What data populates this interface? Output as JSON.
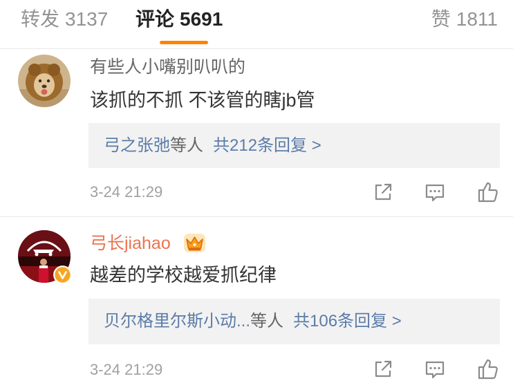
{
  "tabs": [
    {
      "label": "转发",
      "count": "3137"
    },
    {
      "label": "评论",
      "count": "5691"
    },
    {
      "label": "赞",
      "count": "1811"
    }
  ],
  "active_tab": "评论",
  "colors": {
    "accent": "#ff8200",
    "link": "#5b7ca8",
    "vip_name": "#eb7350",
    "text": "#333333",
    "muted": "#a0a0a0",
    "reply_bg": "#f2f2f2",
    "icon": "#8a8a8a"
  },
  "comments": [
    {
      "avatar": "lion-avatar",
      "verified": false,
      "username": "有些人小嘴别叭叭的",
      "badge": null,
      "text": "该抓的不抓 不该管的瞎jb管",
      "reply_users": "弓之张弛",
      "reply_suffix": "等人",
      "reply_summary": "共212条回复 >",
      "time": "3-24 21:29",
      "actions": [
        "share-icon",
        "comment-icon",
        "like-icon"
      ]
    },
    {
      "avatar": "football-fan-avatar",
      "verified": true,
      "username": "弓长jiahao",
      "badge": "crown-icon",
      "text": "越差的学校越爱抓纪律",
      "reply_users": "贝尔格里尔斯小动...",
      "reply_suffix": "等人",
      "reply_summary": "共106条回复 >",
      "time": "3-24 21:29",
      "actions": [
        "share-icon",
        "comment-icon",
        "like-icon"
      ]
    }
  ]
}
